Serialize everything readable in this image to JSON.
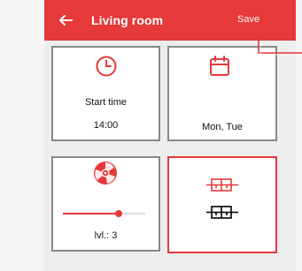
{
  "header": {
    "title": "Living room",
    "save_label": "Save"
  },
  "cards": {
    "start_time": {
      "label": "Start time",
      "value": "14:00"
    },
    "days": {
      "value": "Mon, Tue"
    },
    "level": {
      "value_label": "lvl.: 3",
      "slider_value": 0.68
    },
    "mode": {
      "selected": true
    }
  },
  "colors": {
    "accent": "#e5393a"
  },
  "icons": {
    "back": "arrow-left-icon",
    "clock": "clock-icon",
    "calendar": "calendar-icon",
    "fan": "fan-icon",
    "mode_top": "window-open-icon",
    "mode_bottom": "window-closed-icon"
  }
}
